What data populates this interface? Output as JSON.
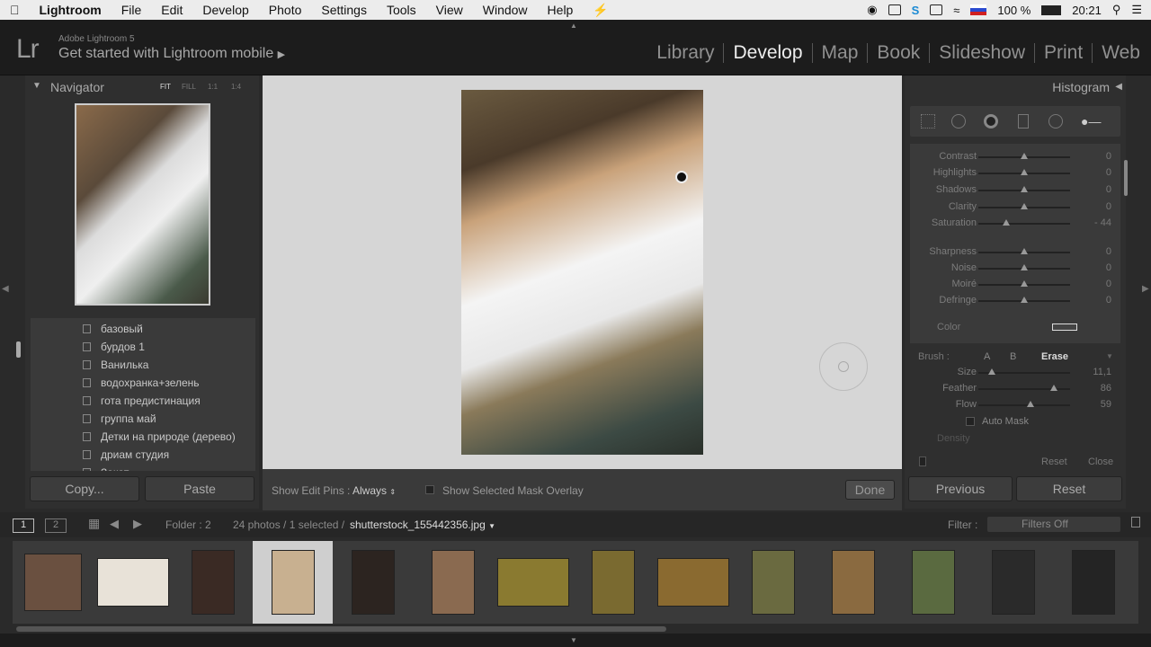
{
  "menubar": {
    "apple": "",
    "app": "Lightroom",
    "items": [
      "File",
      "Edit",
      "Develop",
      "Photo",
      "Settings",
      "Tools",
      "View",
      "Window",
      "Help"
    ],
    "battery": "100 %",
    "time": "20:21"
  },
  "topbar": {
    "logo": "Lr",
    "subtitle": "Adobe Lightroom 5",
    "mobile": "Get started with Lightroom mobile",
    "modules": [
      "Library",
      "Develop",
      "Map",
      "Book",
      "Slideshow",
      "Print",
      "Web"
    ],
    "active_module": "Develop"
  },
  "navigator": {
    "title": "Navigator",
    "zoom": [
      "FIT",
      "FILL",
      "1:1",
      "1:4"
    ]
  },
  "presets": [
    "базовый",
    "бурдов 1",
    "Ванилька",
    "водохранка+зелень",
    "гота предистинация",
    "группа май",
    "Детки на природе (дерево)",
    "дриам студия",
    "Закат"
  ],
  "left_buttons": {
    "copy": "Copy...",
    "paste": "Paste"
  },
  "histogram": {
    "title": "Histogram"
  },
  "adjustments": [
    {
      "label": "Contrast",
      "value": "0",
      "pos": 0.5
    },
    {
      "label": "Highlights",
      "value": "0",
      "pos": 0.5
    },
    {
      "label": "Shadows",
      "value": "0",
      "pos": 0.5
    },
    {
      "label": "Clarity",
      "value": "0",
      "pos": 0.5
    },
    {
      "label": "Saturation",
      "value": "- 44",
      "pos": 0.3
    },
    {
      "label": "Sharpness",
      "value": "0",
      "pos": 0.5
    },
    {
      "label": "Noise",
      "value": "0",
      "pos": 0.5
    },
    {
      "label": "Moiré",
      "value": "0",
      "pos": 0.5
    },
    {
      "label": "Defringe",
      "value": "0",
      "pos": 0.5
    }
  ],
  "color_label": "Color",
  "brush": {
    "label": "Brush :",
    "a": "A",
    "b": "B",
    "erase": "Erase",
    "auto_mask": "Auto Mask",
    "density": "Density",
    "rows": [
      {
        "label": "Size",
        "value": "11,1",
        "pos": 0.15
      },
      {
        "label": "Feather",
        "value": "86",
        "pos": 0.82
      },
      {
        "label": "Flow",
        "value": "59",
        "pos": 0.57
      }
    ],
    "reset": "Reset",
    "close": "Close"
  },
  "right_buttons": {
    "previous": "Previous",
    "reset": "Reset"
  },
  "toolbar": {
    "show_edit_pins": "Show Edit Pins :",
    "always": "Always",
    "overlay": "Show Selected Mask Overlay",
    "done": "Done"
  },
  "filmbar": {
    "tab1": "1",
    "tab2": "2",
    "folder": "Folder : 2",
    "info": "24 photos / 1 selected /",
    "filename": "shutterstock_155442356.jpg",
    "filter_label": "Filter :",
    "filter_value": "Filters Off"
  },
  "thumbnails": [
    {
      "w": 64,
      "h": 64,
      "c": "#6a5040"
    },
    {
      "w": 80,
      "h": 54,
      "c": "#e8e2d8"
    },
    {
      "w": 48,
      "h": 72,
      "c": "#3a2a24"
    },
    {
      "w": 48,
      "h": 72,
      "c": "#c8b090",
      "selected": true
    },
    {
      "w": 48,
      "h": 72,
      "c": "#2c2420"
    },
    {
      "w": 48,
      "h": 72,
      "c": "#8a6a50"
    },
    {
      "w": 80,
      "h": 54,
      "c": "#8a7a30"
    },
    {
      "w": 48,
      "h": 72,
      "c": "#7a6a30"
    },
    {
      "w": 80,
      "h": 54,
      "c": "#8a6a30"
    },
    {
      "w": 48,
      "h": 72,
      "c": "#6a6a40"
    },
    {
      "w": 48,
      "h": 72,
      "c": "#8a6a40"
    },
    {
      "w": 48,
      "h": 72,
      "c": "#5a6a40"
    },
    {
      "w": 48,
      "h": 72,
      "c": "#2a2a2a"
    },
    {
      "w": 48,
      "h": 72,
      "c": "#242424"
    }
  ]
}
